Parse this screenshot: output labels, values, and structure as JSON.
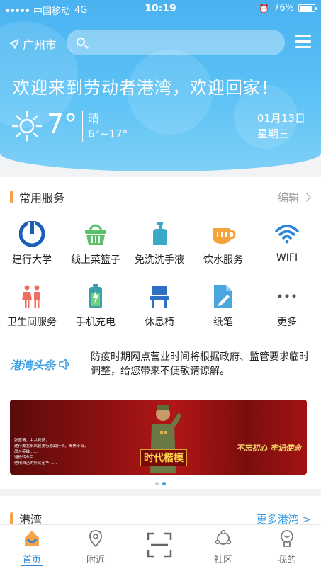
{
  "status_bar": {
    "carrier": "中国移动",
    "network": "4G",
    "time": "10:19",
    "battery": "76%"
  },
  "header": {
    "location": "广州市",
    "search_placeholder": "",
    "welcome": "欢迎来到劳动者港湾，欢迎回家！",
    "weather": {
      "temperature": "7°",
      "condition": "晴",
      "range": "6°~17°",
      "icon": "sun-icon"
    },
    "date": "01月13日",
    "weekday": "星期三"
  },
  "services": {
    "title": "常用服务",
    "edit_label": "编辑",
    "items": [
      {
        "label": "建行大学",
        "icon": "ccb-logo-icon"
      },
      {
        "label": "线上菜篮子",
        "icon": "basket-icon"
      },
      {
        "label": "免洗洗手液",
        "icon": "sanitizer-icon"
      },
      {
        "label": "饮水服务",
        "icon": "cup-icon"
      },
      {
        "label": "WIFI",
        "icon": "wifi-icon"
      },
      {
        "label": "卫生间服务",
        "icon": "restroom-icon"
      },
      {
        "label": "手机充电",
        "icon": "battery-charge-icon"
      },
      {
        "label": "休息椅",
        "icon": "chair-icon"
      },
      {
        "label": "纸笔",
        "icon": "paper-pen-icon"
      },
      {
        "label": "更多",
        "icon": "more-icon"
      }
    ]
  },
  "notice": {
    "brand": "港湾头条",
    "text": "防疫时期网点营业时间将根据政府、监管要求临时调整，给您带来不便敬请谅解。"
  },
  "banner": {
    "text_lines": [
      "张富清，中共党员，",
      "建行湖北来凤县支行原副行长、离休干部。",
      "战斗英雄……",
      "退役转业后……",
      "他用自己的朴实无华……"
    ],
    "badge": "时代楷模",
    "slogan": "不忘初心 牢记使命",
    "slides": 2,
    "active_slide": 2
  },
  "second_section": {
    "title": "港湾",
    "more_label": "更多港湾 >"
  },
  "tabbar": [
    {
      "label": "首页",
      "icon": "home-icon",
      "active": true
    },
    {
      "label": "附近",
      "icon": "location-pin-icon",
      "active": false
    },
    {
      "label": "",
      "icon": "scan-icon",
      "active": false
    },
    {
      "label": "社区",
      "icon": "community-icon",
      "active": false
    },
    {
      "label": "我的",
      "icon": "profile-icon",
      "active": false
    }
  ],
  "colors": {
    "primary": "#4bb3f0",
    "accent": "#f5a34a",
    "link": "#3a9fe6"
  }
}
